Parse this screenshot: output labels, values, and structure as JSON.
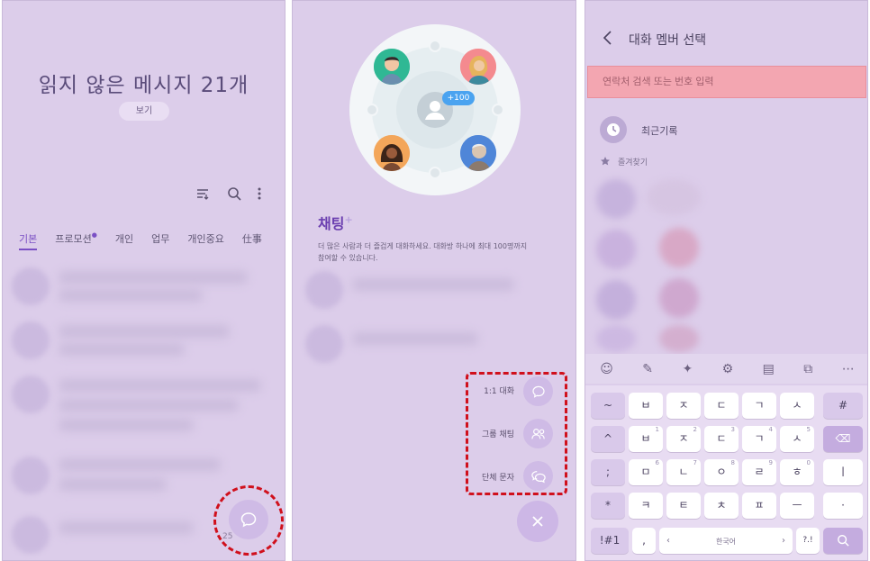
{
  "panel1": {
    "unread_title": "읽지 않은 메시지 21개",
    "view_button": "보기",
    "tabs": [
      {
        "label": "기본",
        "active": true
      },
      {
        "label": "프로모션"
      },
      {
        "label": "개인"
      },
      {
        "label": "업무"
      },
      {
        "label": "개인중요"
      },
      {
        "label": "仕事"
      }
    ],
    "count_small": "25"
  },
  "panel2": {
    "badge": "+100",
    "title": "채팅",
    "title_plus": "+",
    "description": "더 많은 사람과 더 즐겁게 대화하세요. 대화방 하나에 최대 100명까지 참여할 수 있습니다.",
    "menu": [
      {
        "label": "1:1 대화"
      },
      {
        "label": "그룹 채팅"
      },
      {
        "label": "단체 문자"
      }
    ]
  },
  "panel3": {
    "header_title": "대화 멤버 선택",
    "search_placeholder": "연락처 검색 또는 번호 입력",
    "recent_label": "최근기록",
    "favorites_label": "즐겨찾기",
    "keyboard_rows": [
      [
        {
          "m": "~",
          "fn": true
        },
        {
          "m": "ㅂ"
        },
        {
          "m": "ㅈ"
        },
        {
          "m": "ㄷ"
        },
        {
          "m": "ㄱ"
        },
        {
          "m": "ㅅ"
        },
        {
          "m": "#",
          "fn": true
        }
      ],
      [
        {
          "m": "^",
          "fn": true
        },
        {
          "m": "ㅂ",
          "s": "1"
        },
        {
          "m": "ㅈ",
          "s": "2"
        },
        {
          "m": "ㄷ",
          "s": "3"
        },
        {
          "m": "ㄱ",
          "s": "4"
        },
        {
          "m": "ㅅ",
          "s": "5"
        },
        {
          "m": "⌫",
          "fn": true,
          "accent": true
        }
      ],
      [
        {
          "m": ";",
          "fn": true
        },
        {
          "m": "ㅁ",
          "s": "6"
        },
        {
          "m": "ㄴ",
          "s": "7"
        },
        {
          "m": "ㅇ",
          "s": "8"
        },
        {
          "m": "ㄹ",
          "s": "9"
        },
        {
          "m": "ㅎ",
          "s": "0"
        },
        {
          "m": "ㅣ"
        }
      ],
      [
        {
          "m": "*",
          "fn": true
        },
        {
          "m": "ㅋ"
        },
        {
          "m": "ㅌ"
        },
        {
          "m": "ㅊ"
        },
        {
          "m": "ㅍ"
        },
        {
          "m": "ㅡ"
        },
        {
          "m": "·"
        }
      ]
    ],
    "symbol_key": "!#1",
    "comma_key": ",",
    "space_label": "한국어",
    "punct_key": "?.!"
  }
}
